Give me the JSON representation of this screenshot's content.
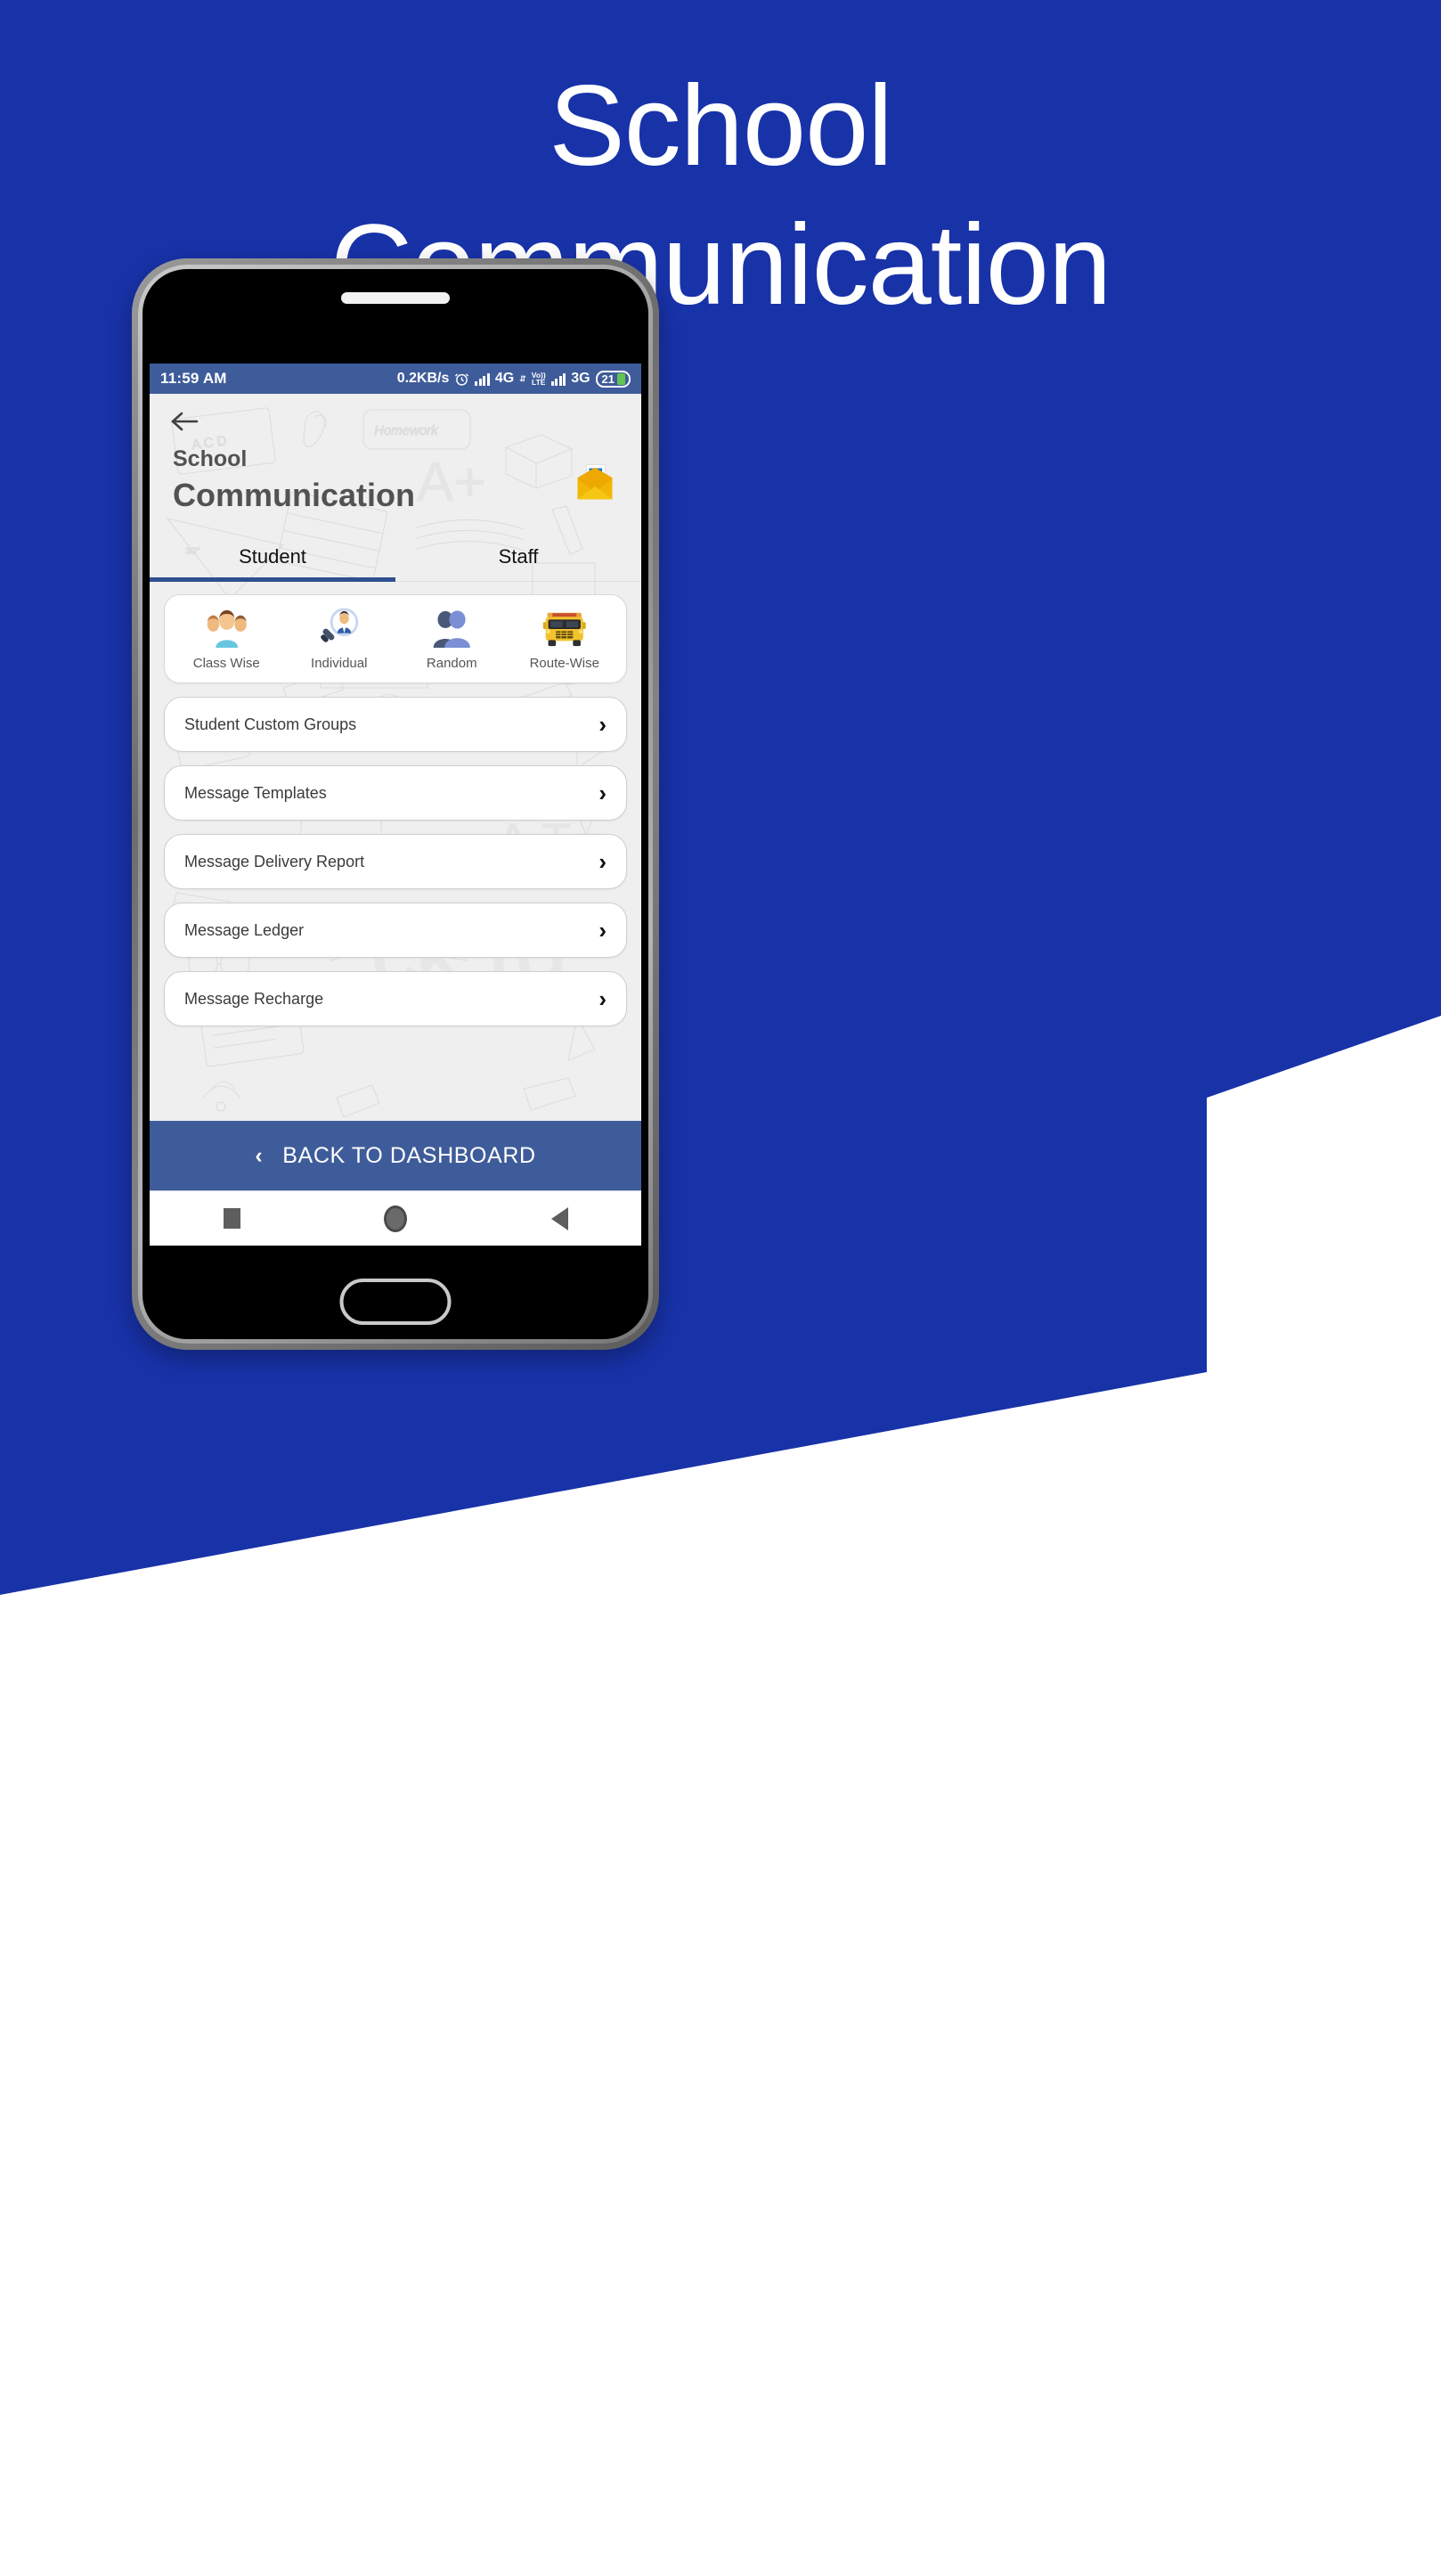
{
  "promo": {
    "title_line1": "School",
    "title_line2": "Communication",
    "brand_blue": "#1832a8"
  },
  "status_bar": {
    "time": "11:59 AM",
    "data_rate": "0.2KB/s",
    "alarm_icon": "alarm-clock-icon",
    "network1_label": "4G",
    "transfer_icon": "data-transfer-icon",
    "volte_top": "Vo))",
    "volte_bottom": "LTE",
    "network2_label": "3G",
    "battery_level": "21",
    "bar_color": "#3f5c9a"
  },
  "app": {
    "back_icon": "back-arrow-icon",
    "title_small": "School",
    "title_large": "Communication",
    "header_icon": "incoming-envelope-icon",
    "tabs": [
      {
        "label": "Student",
        "active": true
      },
      {
        "label": "Staff",
        "active": false
      }
    ],
    "quick_actions": [
      {
        "label": "Class Wise",
        "icon": "people-group-icon"
      },
      {
        "label": "Individual",
        "icon": "magnifier-person-icon"
      },
      {
        "label": "Random",
        "icon": "two-silhouettes-icon"
      },
      {
        "label": "Route-Wise",
        "icon": "school-bus-icon"
      }
    ],
    "menu_items": [
      {
        "label": "Student Custom Groups",
        "chevron": "›"
      },
      {
        "label": "Message Templates",
        "chevron": "›"
      },
      {
        "label": "Message Delivery Report",
        "chevron": "›"
      },
      {
        "label": "Message Ledger",
        "chevron": "›"
      },
      {
        "label": "Message Recharge",
        "chevron": "›"
      }
    ],
    "bottom_bar": {
      "chevron": "‹",
      "label": "BACK TO DASHBOARD",
      "color": "#3f5c9a"
    },
    "nav_bar": {
      "recents_icon": "square-recents-icon",
      "home_icon": "circle-home-icon",
      "back_icon": "triangle-back-icon"
    }
  }
}
